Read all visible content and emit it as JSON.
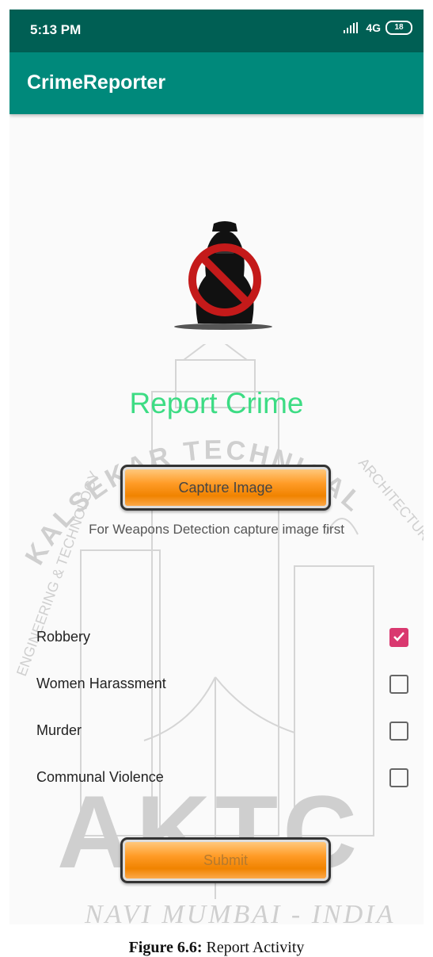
{
  "status_bar": {
    "time": "5:13 PM",
    "network": "4G",
    "battery": "18"
  },
  "app_bar": {
    "title": "CrimeReporter"
  },
  "main": {
    "logo_icon": "no-crime-hooded-figure-icon",
    "title": "Report Crime",
    "capture_button": "Capture Image",
    "hint": "For Weapons Detection capture image first",
    "options": [
      {
        "label": "Robbery",
        "checked": true
      },
      {
        "label": "Women Harassment",
        "checked": false
      },
      {
        "label": "Murder",
        "checked": false
      },
      {
        "label": "Communal Violence",
        "checked": false
      }
    ],
    "submit_button": "Submit"
  },
  "caption": {
    "label": "Figure 6.6:",
    "text": "Report Activity"
  },
  "watermark": {
    "top_arc": "KALSEKAR TECHNICAL",
    "line2": "ENGINEERING & TECHNOLOGY",
    "line2_right": "ARCHITECTURE",
    "logo": "AKTC",
    "bottom": "NAVI MUMBAI - INDIA"
  },
  "colors": {
    "status_bar": "#005f54",
    "app_bar": "#00897b",
    "title": "#3ddc84",
    "checkbox_checked": "#d9386f",
    "button": "#f08300"
  }
}
